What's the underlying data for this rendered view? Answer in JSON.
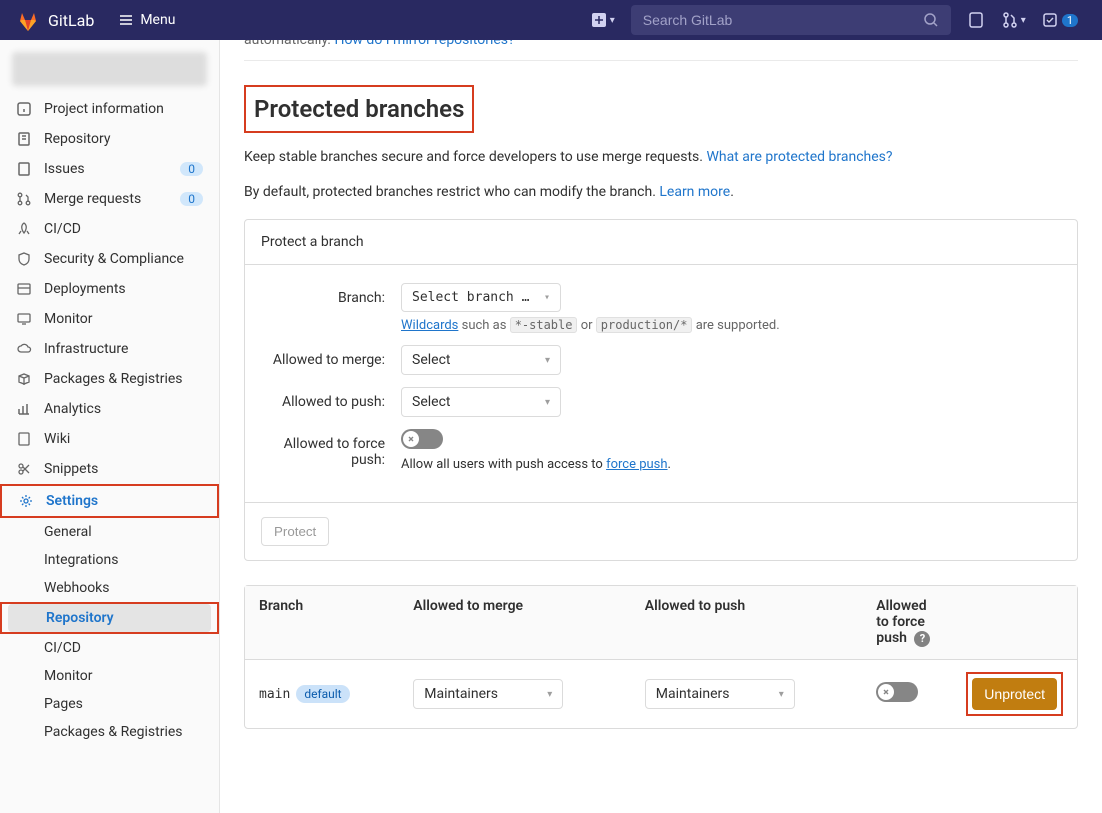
{
  "topbar": {
    "brand": "GitLab",
    "menu": "Menu",
    "search_placeholder": "Search GitLab",
    "todo_count": "1"
  },
  "sidebar": {
    "items": [
      {
        "label": "Project information"
      },
      {
        "label": "Repository"
      },
      {
        "label": "Issues",
        "count": "0"
      },
      {
        "label": "Merge requests",
        "count": "0"
      },
      {
        "label": "CI/CD"
      },
      {
        "label": "Security & Compliance"
      },
      {
        "label": "Deployments"
      },
      {
        "label": "Monitor"
      },
      {
        "label": "Infrastructure"
      },
      {
        "label": "Packages & Registries"
      },
      {
        "label": "Analytics"
      },
      {
        "label": "Wiki"
      },
      {
        "label": "Snippets"
      },
      {
        "label": "Settings"
      }
    ],
    "settings_sub": [
      "General",
      "Integrations",
      "Webhooks",
      "Repository",
      "CI/CD",
      "Monitor",
      "Pages",
      "Packages & Registries"
    ]
  },
  "main": {
    "truncated_prefix": "automatically. ",
    "truncated_link": "How do I mirror repositories?",
    "title": "Protected branches",
    "desc1_a": "Keep stable branches secure and force developers to use merge requests. ",
    "desc1_link": "What are protected branches?",
    "desc2_a": "By default, protected branches restrict who can modify the branch. ",
    "desc2_link": "Learn more",
    "desc2_b": ".",
    "card": {
      "title": "Protect a branch",
      "branch_label": "Branch:",
      "branch_sel": "Select branch …",
      "wildcard_a": "Wildcards",
      "wildcard_b": " such as ",
      "wc1": "*-stable",
      "wildcard_c": " or ",
      "wc2": "production/*",
      "wildcard_d": " are supported.",
      "merge_label": "Allowed to merge:",
      "merge_sel": "Select",
      "push_label": "Allowed to push:",
      "push_sel": "Select",
      "force_label": "Allowed to force push:",
      "force_hint_a": "Allow all users with push access to ",
      "force_hint_link": "force push",
      "force_hint_b": ".",
      "protect_btn": "Protect"
    },
    "table": {
      "h_branch": "Branch",
      "h_merge": "Allowed to merge",
      "h_push": "Allowed to push",
      "h_force": "Allowed to force push",
      "row": {
        "name": "main",
        "tag": "default",
        "merge": "Maintainers",
        "push": "Maintainers",
        "unprotect": "Unprotect"
      }
    }
  }
}
